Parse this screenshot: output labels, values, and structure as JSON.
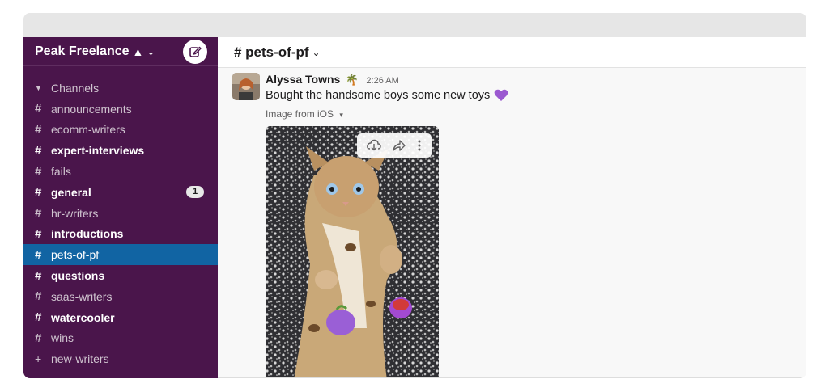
{
  "workspace": {
    "name": "Peak Freelance",
    "triangle": "▲",
    "chevron": "⌄",
    "compose_icon": "compose-icon"
  },
  "sidebar": {
    "section_label": "Channels",
    "channels": [
      {
        "label": "announcements",
        "bold": false
      },
      {
        "label": "ecomm-writers",
        "bold": false
      },
      {
        "label": "expert-interviews",
        "bold": true
      },
      {
        "label": "fails",
        "bold": false
      },
      {
        "label": "general",
        "bold": true,
        "badge": "1"
      },
      {
        "label": "hr-writers",
        "bold": false
      },
      {
        "label": "introductions",
        "bold": true
      },
      {
        "label": "pets-of-pf",
        "bold": false,
        "active": true
      },
      {
        "label": "questions",
        "bold": true
      },
      {
        "label": "saas-writers",
        "bold": false
      },
      {
        "label": "watercooler",
        "bold": true
      },
      {
        "label": "wins",
        "bold": false
      }
    ],
    "add_channel": "new-writers"
  },
  "channel": {
    "title": "# pets-of-pf",
    "chevron": "⌄"
  },
  "message": {
    "author": "Alyssa Towns",
    "status_emoji": "🌴",
    "time": "2:26 AM",
    "text": "Bought the handsome boys some new toys",
    "image_label": "Image from iOS",
    "image_caret": "▾"
  },
  "colors": {
    "sidebar_bg": "#4a154b",
    "active_bg": "#1164a3",
    "heart": "#9b59d0"
  }
}
